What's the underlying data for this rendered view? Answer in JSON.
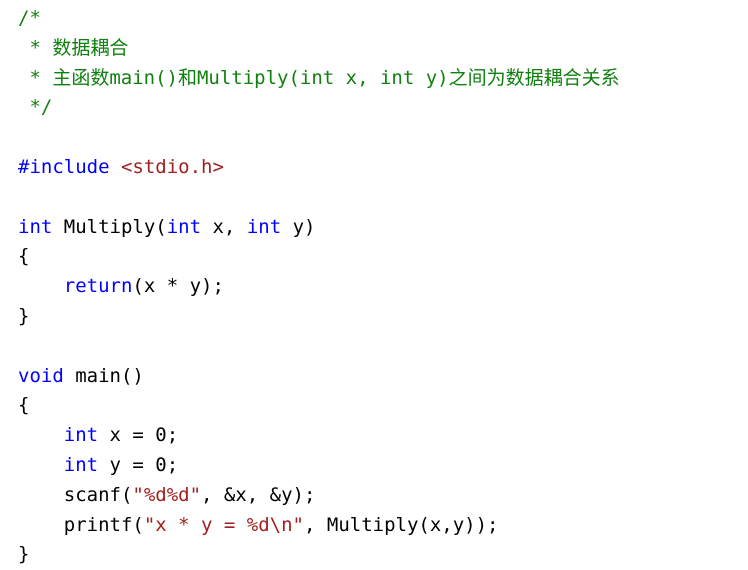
{
  "document": {
    "kind": "source-code-listing",
    "language": "C",
    "background_color": "#ffffff",
    "colors": {
      "comment": "#108010",
      "keyword": "#0000ff",
      "string": "#a02020",
      "plain": "#000000"
    },
    "lines": [
      {
        "n": 1,
        "tokens": [
          {
            "t": "/*",
            "c": "comment"
          }
        ]
      },
      {
        "n": 2,
        "tokens": [
          {
            "t": " * 数据耦合",
            "c": "comment"
          }
        ]
      },
      {
        "n": 3,
        "tokens": [
          {
            "t": " * 主函数main()和Multiply(int x, int y)之间为数据耦合关系",
            "c": "comment"
          }
        ]
      },
      {
        "n": 4,
        "tokens": [
          {
            "t": " */",
            "c": "comment"
          }
        ]
      },
      {
        "n": 5,
        "tokens": [
          {
            "t": "",
            "c": "plain"
          }
        ]
      },
      {
        "n": 6,
        "tokens": [
          {
            "t": "#include ",
            "c": "keyword"
          },
          {
            "t": "<stdio.h>",
            "c": "string"
          }
        ]
      },
      {
        "n": 7,
        "tokens": [
          {
            "t": "",
            "c": "plain"
          }
        ]
      },
      {
        "n": 8,
        "tokens": [
          {
            "t": "int",
            "c": "keyword"
          },
          {
            "t": " Multiply(",
            "c": "plain"
          },
          {
            "t": "int",
            "c": "keyword"
          },
          {
            "t": " x, ",
            "c": "plain"
          },
          {
            "t": "int",
            "c": "keyword"
          },
          {
            "t": " y)",
            "c": "plain"
          }
        ]
      },
      {
        "n": 9,
        "tokens": [
          {
            "t": "{",
            "c": "plain"
          }
        ]
      },
      {
        "n": 10,
        "tokens": [
          {
            "t": "    ",
            "c": "plain"
          },
          {
            "t": "return",
            "c": "keyword"
          },
          {
            "t": "(x * y);",
            "c": "plain"
          }
        ]
      },
      {
        "n": 11,
        "tokens": [
          {
            "t": "}",
            "c": "plain"
          }
        ]
      },
      {
        "n": 12,
        "tokens": [
          {
            "t": "",
            "c": "plain"
          }
        ]
      },
      {
        "n": 13,
        "tokens": [
          {
            "t": "void",
            "c": "keyword"
          },
          {
            "t": " main()",
            "c": "plain"
          }
        ]
      },
      {
        "n": 14,
        "tokens": [
          {
            "t": "{",
            "c": "plain"
          }
        ]
      },
      {
        "n": 15,
        "tokens": [
          {
            "t": "    ",
            "c": "plain"
          },
          {
            "t": "int",
            "c": "keyword"
          },
          {
            "t": " x = 0;",
            "c": "plain"
          }
        ]
      },
      {
        "n": 16,
        "tokens": [
          {
            "t": "    ",
            "c": "plain"
          },
          {
            "t": "int",
            "c": "keyword"
          },
          {
            "t": " y = 0;",
            "c": "plain"
          }
        ]
      },
      {
        "n": 17,
        "tokens": [
          {
            "t": "    scanf(",
            "c": "plain"
          },
          {
            "t": "\"%d%d\"",
            "c": "string"
          },
          {
            "t": ", &x, &y);",
            "c": "plain"
          }
        ]
      },
      {
        "n": 18,
        "tokens": [
          {
            "t": "    printf(",
            "c": "plain"
          },
          {
            "t": "\"x * y = %d\\n\"",
            "c": "string"
          },
          {
            "t": ", Multiply(x,y));",
            "c": "plain"
          }
        ]
      },
      {
        "n": 19,
        "tokens": [
          {
            "t": "}",
            "c": "plain"
          }
        ]
      }
    ]
  }
}
